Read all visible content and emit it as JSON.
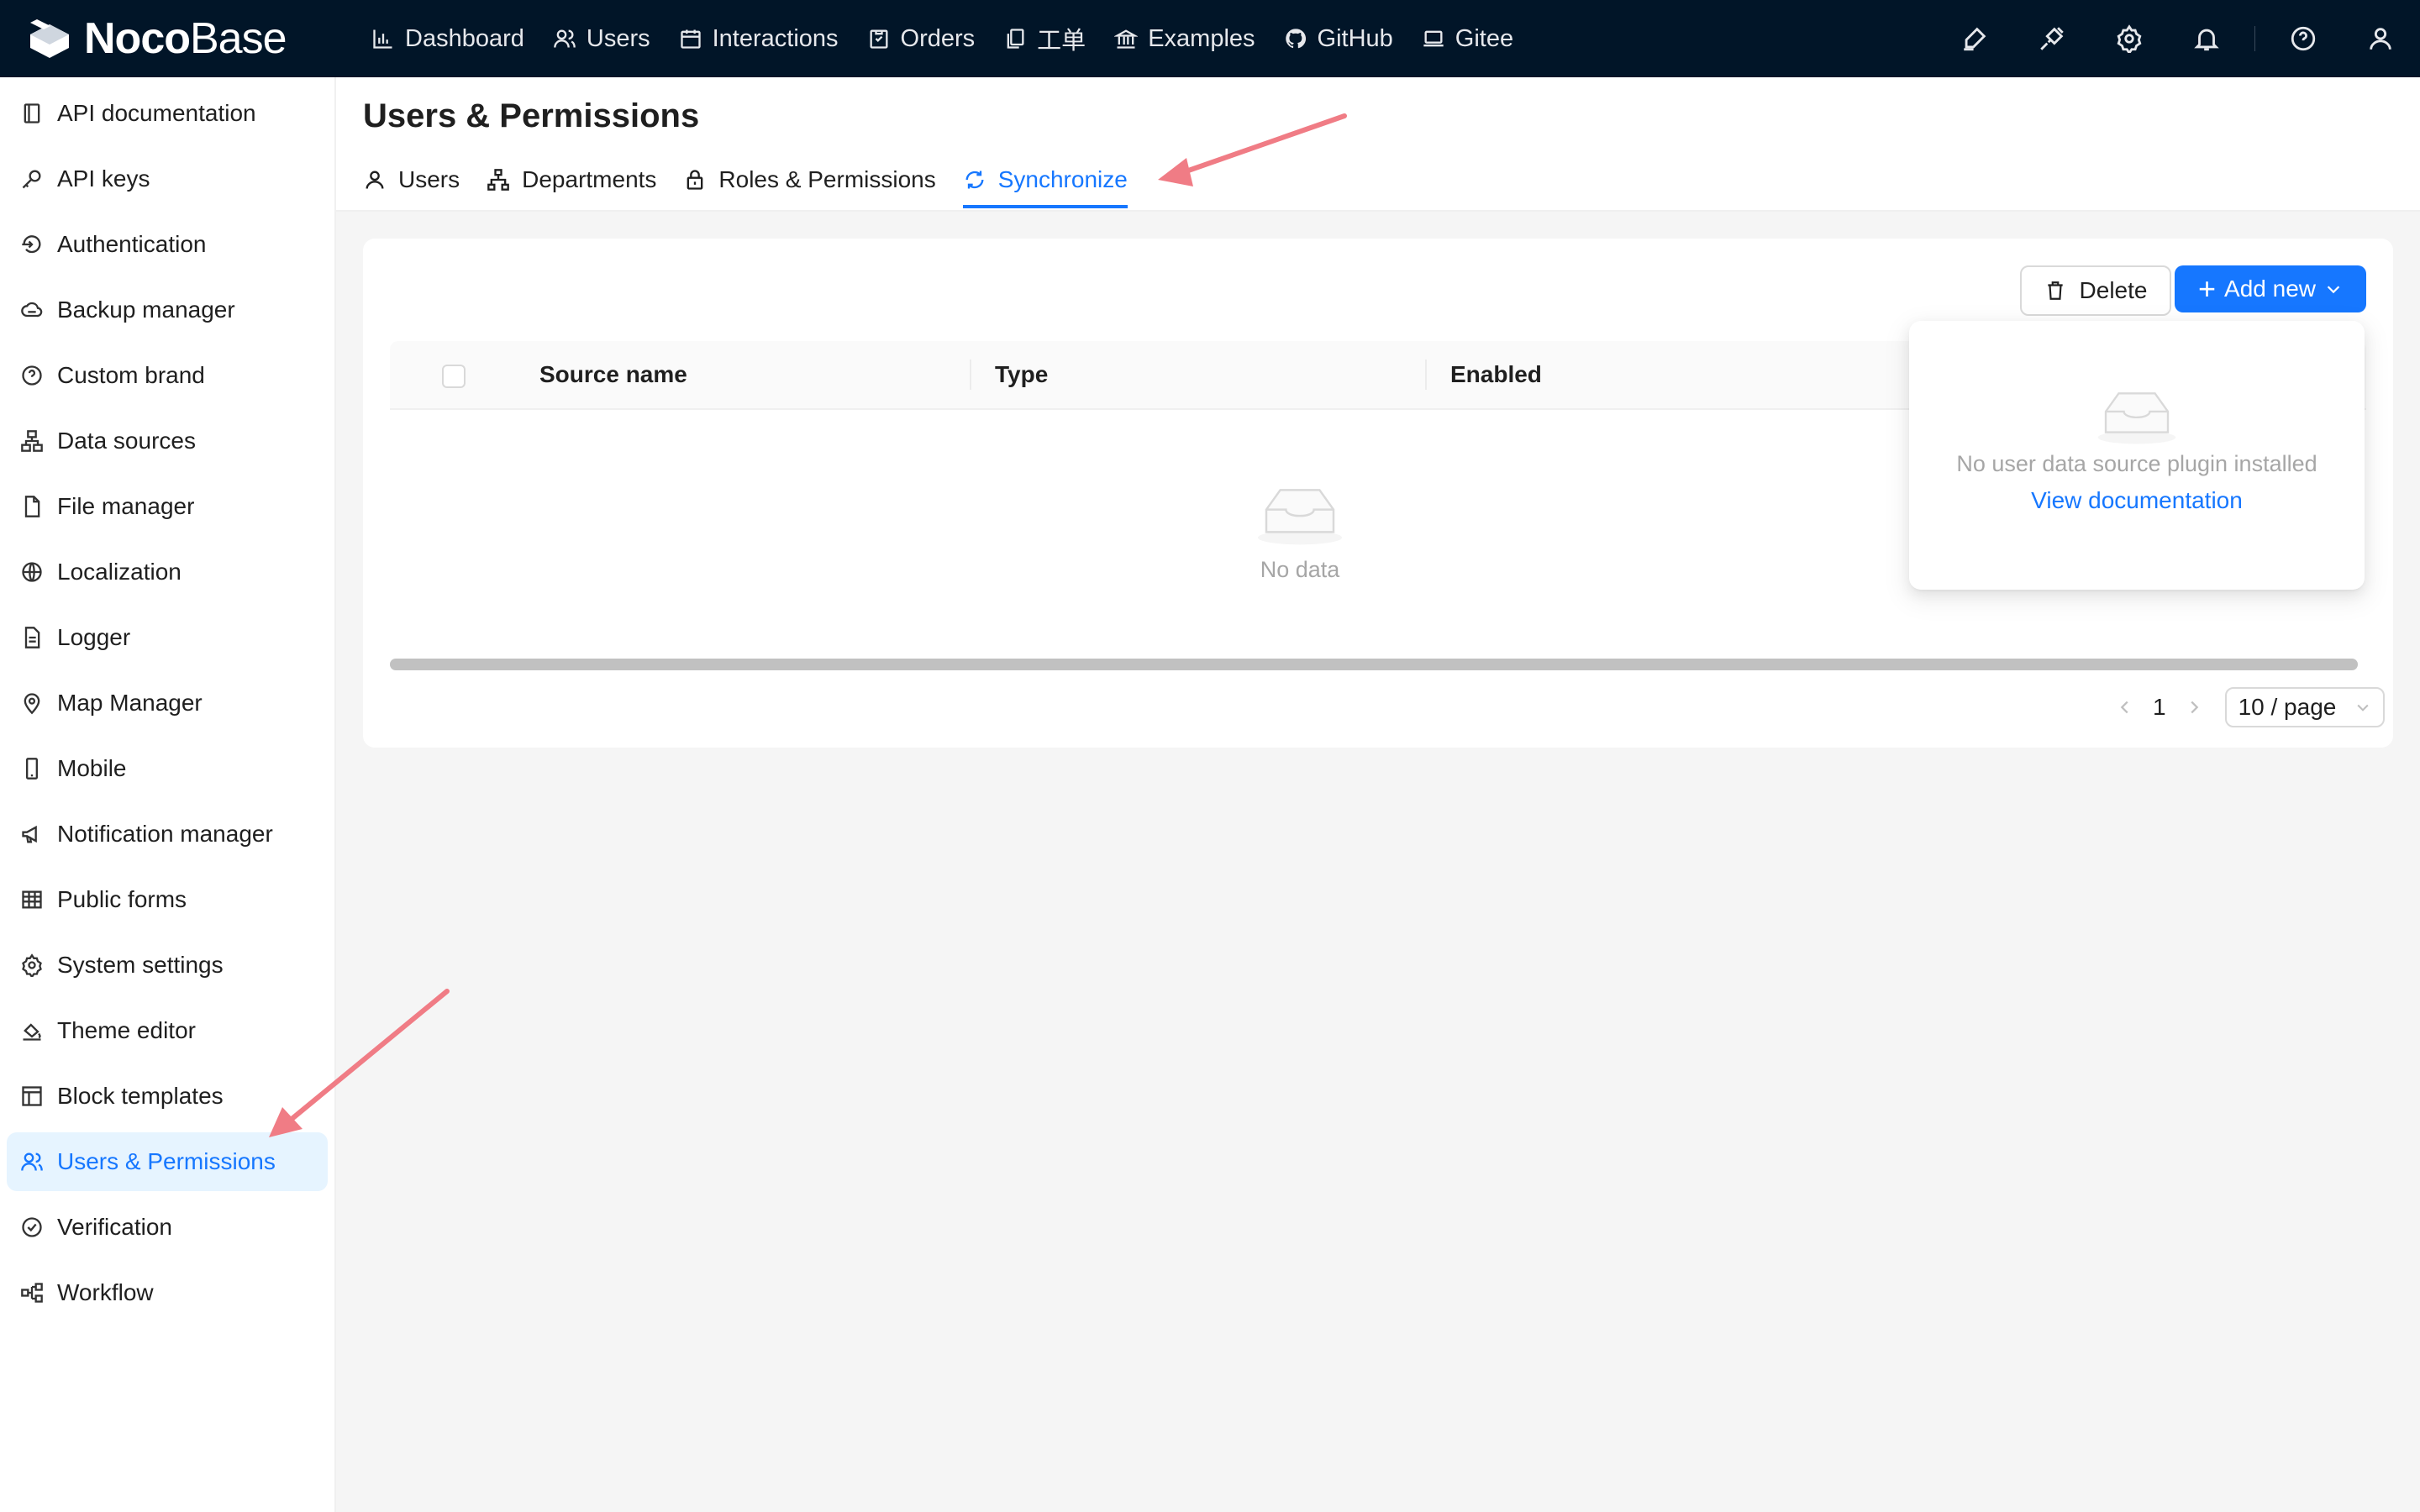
{
  "brand": {
    "logo_bold": "Noco",
    "logo_light": "Base"
  },
  "topnav": [
    {
      "label": "Dashboard",
      "icon": "bar-chart-icon"
    },
    {
      "label": "Users",
      "icon": "users-icon"
    },
    {
      "label": "Interactions",
      "icon": "calendar-icon"
    },
    {
      "label": "Orders",
      "icon": "order-icon"
    },
    {
      "label": "工单",
      "icon": "copy-icon"
    },
    {
      "label": "Examples",
      "icon": "bank-icon"
    },
    {
      "label": "GitHub",
      "icon": "github-icon"
    },
    {
      "label": "Gitee",
      "icon": "laptop-icon"
    }
  ],
  "topbar_actions": [
    "highlight-icon",
    "plugin-icon",
    "settings-icon",
    "bell-icon",
    "help-icon",
    "user-icon"
  ],
  "sidebar": [
    {
      "label": "API documentation",
      "icon": "book-icon"
    },
    {
      "label": "API keys",
      "icon": "key-icon"
    },
    {
      "label": "Authentication",
      "icon": "login-icon"
    },
    {
      "label": "Backup manager",
      "icon": "cloud-icon"
    },
    {
      "label": "Custom brand",
      "icon": "question-circle-icon"
    },
    {
      "label": "Data sources",
      "icon": "cluster-icon"
    },
    {
      "label": "File manager",
      "icon": "file-icon"
    },
    {
      "label": "Localization",
      "icon": "globe-icon"
    },
    {
      "label": "Logger",
      "icon": "file-text-icon"
    },
    {
      "label": "Map Manager",
      "icon": "location-icon"
    },
    {
      "label": "Mobile",
      "icon": "mobile-icon"
    },
    {
      "label": "Notification manager",
      "icon": "megaphone-icon"
    },
    {
      "label": "Public forms",
      "icon": "table-icon"
    },
    {
      "label": "System settings",
      "icon": "gear-icon"
    },
    {
      "label": "Theme editor",
      "icon": "paint-bucket-icon"
    },
    {
      "label": "Block templates",
      "icon": "layout-icon"
    },
    {
      "label": "Users & Permissions",
      "icon": "users-icon",
      "active": true
    },
    {
      "label": "Verification",
      "icon": "check-circle-icon"
    },
    {
      "label": "Workflow",
      "icon": "workflow-icon"
    }
  ],
  "page": {
    "title": "Users & Permissions",
    "tabs": [
      {
        "label": "Users",
        "icon": "user-icon"
      },
      {
        "label": "Departments",
        "icon": "apartment-icon"
      },
      {
        "label": "Roles & Permissions",
        "icon": "lock-icon"
      },
      {
        "label": "Synchronize",
        "icon": "sync-icon",
        "active": true
      }
    ]
  },
  "toolbar": {
    "delete_label": "Delete",
    "add_label": "Add new"
  },
  "table": {
    "columns": [
      "Source name",
      "Type",
      "Enabled"
    ],
    "empty_text": "No data"
  },
  "pagination": {
    "current_page": "1",
    "page_size": "10 / page"
  },
  "popup": {
    "message": "No user data source plugin installed",
    "link": "View documentation"
  },
  "colors": {
    "topbar": "#011528",
    "primary": "#1677ff",
    "active_bg": "#e6f4ff",
    "annotation": "#f07c85"
  }
}
